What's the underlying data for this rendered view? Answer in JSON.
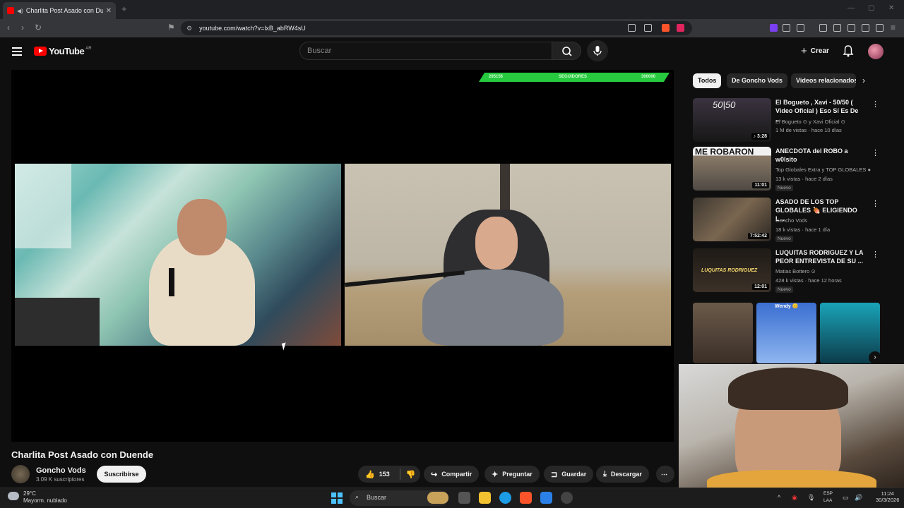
{
  "browser": {
    "tab_title": "Charlita Post Asado con Duen",
    "tab_close": "✕",
    "new_tab": "+",
    "url": "youtube.com/watch?v=lxB_abRW4sU"
  },
  "youtube": {
    "logo_text": "YouTube",
    "country_code": "AR",
    "search_placeholder": "Buscar",
    "create_label": "Crear"
  },
  "overlay": {
    "followers_current": "295156",
    "followers_label": "SEGUIDORES",
    "followers_goal": "300000"
  },
  "video": {
    "title": "Charlita Post Asado con Duende",
    "channel": "Goncho Vods",
    "subscribers": "3.09 K suscriptores",
    "subscribe_label": "Suscribirse",
    "likes": "153",
    "share_label": "Compartir",
    "ask_label": "Preguntar",
    "save_label": "Guardar",
    "download_label": "Descargar"
  },
  "sidebar": {
    "chips": [
      "Todos",
      "De Goncho Vods",
      "Videos relacionados"
    ],
    "recommendations": [
      {
        "title": "El Bogueto , Xavi - 50/50 ( Video Oficial ) Eso Sí Es De ...",
        "channel": "El Bogueto ⊙ y Xavi Oficial ⊙",
        "meta": "1 M de vistas · hace 10 días",
        "duration": "♪ 3:28",
        "badge": "",
        "thumb_text": "50|50"
      },
      {
        "title": "ANECDOTA del ROBO a w0lsito",
        "channel": "Top Globales Extra y TOP GLOBALES ●",
        "meta": "13 k vistas · hace 2 días",
        "duration": "11:01",
        "badge": "Nuevo",
        "thumb_text": "ME ROBARON"
      },
      {
        "title": "ASADO DE LOS TOP GLOBALES 🍖 ELIGIENDO L...",
        "channel": "Goncho Vods",
        "meta": "18 k vistas · hace 1 día",
        "duration": "7:52:42",
        "badge": "Nuevo",
        "thumb_text": ""
      },
      {
        "title": "LUQUITAS RODRIGUEZ Y LA PEOR ENTREVISTA DE SU ...",
        "channel": "Matias Bottero ⊙",
        "meta": "428 k vistas · hace 12 horas",
        "duration": "12:01",
        "badge": "Nuevo",
        "thumb_text": "LUQUITAS RODRIGUEZ"
      }
    ],
    "shorts_label": "Wendy 😊"
  },
  "taskbar": {
    "temperature": "29°C",
    "weather": "Mayorm. nublado",
    "search_label": "Buscar",
    "lang": "ESP",
    "lang2": "LAA",
    "time": "11:24",
    "date": "30/3/2026"
  },
  "colors": {
    "youtube_red": "#ff0000",
    "follower_bar": "#27c93f",
    "background": "#0f0f0f"
  }
}
